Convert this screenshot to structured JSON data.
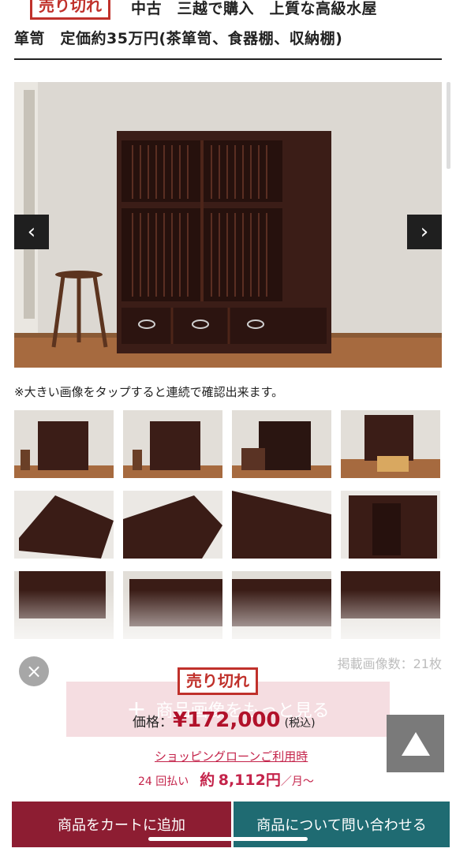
{
  "product": {
    "sold_badge": "売り切れ",
    "title_line1": "中古　三越で購入　上質な高級水屋",
    "title_line2": "箪笥　定価約35万円(茶箪笥、食器棚、収納棚)"
  },
  "gallery": {
    "note": "※大きい画像をタップすると連続で確認出来ます。",
    "prev_icon": "‹",
    "next_icon": "›",
    "image_count": "掲載画像数：21枚"
  },
  "more": {
    "plus": "+",
    "label": "商品画像をもっと見る"
  },
  "purchase": {
    "sold_badge": "売り切れ",
    "price_label": "価格：",
    "price_value": "¥172,000",
    "price_tax": "(税込)",
    "loan_link": "ショッピングローンご利用時",
    "installment_count": "24 回払い",
    "installment_prefix": "約",
    "installment_amount": "8,112円",
    "installment_suffix": "／月〜"
  },
  "actions": {
    "close_icon": "×",
    "add_to_cart": "商品をカートに追加",
    "inquiry": "商品について問い合わせる"
  },
  "colors": {
    "brand_red": "#c0312b",
    "cart": "#8d1d32",
    "inquiry": "#1f6b72"
  }
}
